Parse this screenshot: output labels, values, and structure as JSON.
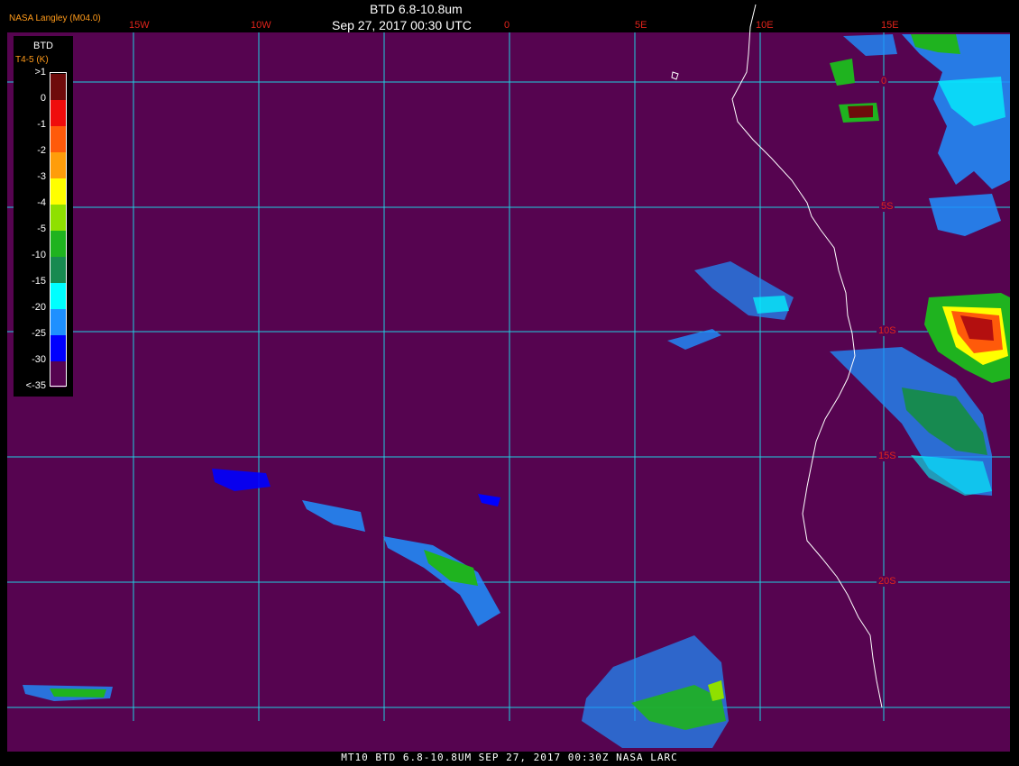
{
  "header": {
    "title": "BTD 6.8-10.8um",
    "datetime": "Sep 27, 2017 00:30 UTC",
    "agency": "NASA Langley (M04.0)"
  },
  "footer": {
    "text": "MT10  BTD 6.8-10.8UM  SEP 27, 2017 00:30Z  NASA LARC"
  },
  "legend": {
    "title": "BTD",
    "unit": "T4-5 (K)",
    "levels": [
      {
        "label": ">1",
        "color": "#6e0b0b"
      },
      {
        "label": "0",
        "color": "#ef0c0c"
      },
      {
        "label": "-1",
        "color": "#ff5a0a"
      },
      {
        "label": "-2",
        "color": "#ff9d0a"
      },
      {
        "label": "-3",
        "color": "#ffff00"
      },
      {
        "label": "-4",
        "color": "#8fe000"
      },
      {
        "label": "-5",
        "color": "#1fb31f"
      },
      {
        "label": "-10",
        "color": "#178a50"
      },
      {
        "label": "-15",
        "color": "#00ffff"
      },
      {
        "label": "-20",
        "color": "#1e90ff"
      },
      {
        "label": "-25",
        "color": "#0000ff"
      },
      {
        "label": "-30",
        "color": "#560450"
      },
      {
        "label": "<-35",
        "color": ""
      }
    ]
  },
  "map": {
    "background_color": "#560450",
    "grid_color": "#1fd0e0",
    "coast_color": "#ffffff",
    "longitude_labels": [
      "15W",
      "10W",
      "0",
      "5E",
      "10E",
      "15E"
    ],
    "latitude_labels": [
      "0",
      "5S",
      "10S",
      "15S",
      "20S"
    ]
  }
}
